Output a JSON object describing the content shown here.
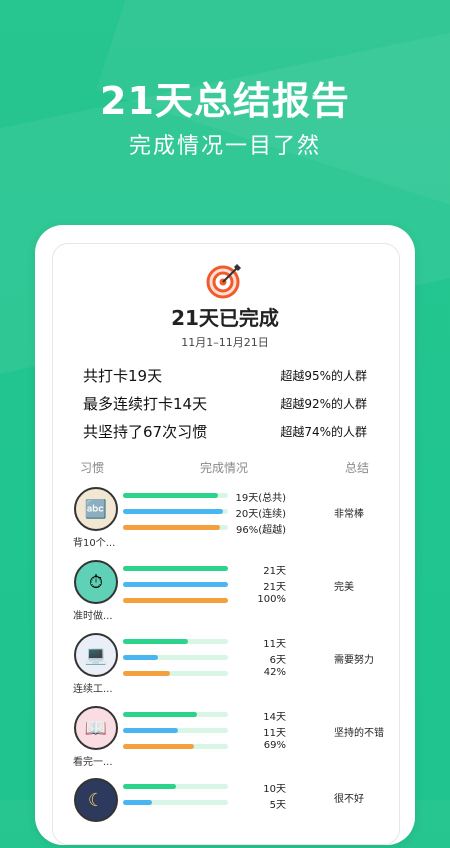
{
  "hero": {
    "title": "21天总结报告",
    "subtitle": "完成情况一目了然"
  },
  "card": {
    "icon": "target-icon",
    "title": "21天已完成",
    "date": "11月1–11月21日",
    "stats": [
      {
        "label": "共打卡19天",
        "value": "超越95%的人群"
      },
      {
        "label": "最多连续打卡14天",
        "value": "超越92%的人群"
      },
      {
        "label": "共坚持了67次习惯",
        "value": "超越74%的人群"
      }
    ],
    "columns": {
      "habit": "习惯",
      "completion": "完成情况",
      "summary": "总结"
    },
    "habits": [
      {
        "name": "背10个...",
        "icon": "abc-blocks-icon",
        "values": [
          "19天(总共)",
          "20天(连续)",
          "96%(超越)"
        ],
        "fills": [
          0.9,
          0.95,
          0.92
        ],
        "summary": "非常棒"
      },
      {
        "name": "准时做...",
        "icon": "stopwatch-icon",
        "values": [
          "21天",
          "21天",
          "100%"
        ],
        "fills": [
          1.0,
          1.0,
          1.0
        ],
        "summary": "完美"
      },
      {
        "name": "连续工...",
        "icon": "desk-worker-icon",
        "values": [
          "11天",
          "6天",
          "42%"
        ],
        "fills": [
          0.62,
          0.33,
          0.45
        ],
        "summary": "需要努力"
      },
      {
        "name": "看完一...",
        "icon": "reading-icon",
        "values": [
          "14天",
          "11天",
          "69%"
        ],
        "fills": [
          0.7,
          0.52,
          0.68
        ],
        "summary": "坚持的不错"
      },
      {
        "name": "",
        "icon": "moon-icon",
        "values": [
          "10天",
          "5天",
          ""
        ],
        "fills": [
          0.5,
          0.28,
          0
        ],
        "summary": "很不好"
      }
    ]
  },
  "colors": {
    "background": "#21c58f",
    "green": "#2bd38b",
    "blue": "#49b6f2",
    "orange": "#f4a03f"
  }
}
